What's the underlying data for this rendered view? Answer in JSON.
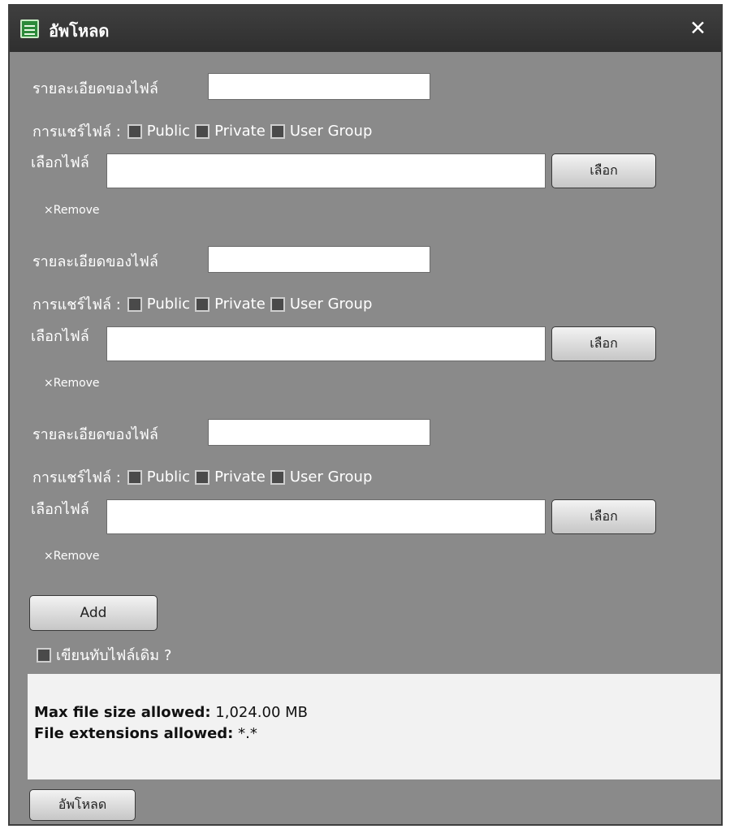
{
  "window": {
    "title": "อัพโหลด",
    "close_symbol": "✕"
  },
  "labels": {
    "description": "รายละเอียดของไฟล์",
    "sharing": "การแชร์ไฟล์ :",
    "choose_file": "เลือกไฟล์",
    "choose_button": "เลือก",
    "remove": "×Remove"
  },
  "share_options": [
    "Public",
    "Private",
    "User Group"
  ],
  "entries": [
    {
      "description": "",
      "file": "",
      "public": false,
      "private": false,
      "user_group": false
    },
    {
      "description": "",
      "file": "",
      "public": false,
      "private": false,
      "user_group": false
    },
    {
      "description": "",
      "file": "",
      "public": false,
      "private": false,
      "user_group": false
    }
  ],
  "add_button": "Add",
  "overwrite": {
    "label": "เขียนทับไฟล์เดิม ?",
    "checked": false
  },
  "info": {
    "max_size_label": "Max file size allowed:",
    "max_size_value": "1,024.00 MB",
    "extensions_label": "File extensions allowed:",
    "extensions_value": "*.*"
  },
  "upload_button": "อัพโหลด",
  "icons": {
    "title": "list-window-icon",
    "close": "close-icon",
    "checkbox": "checkbox-icon"
  }
}
